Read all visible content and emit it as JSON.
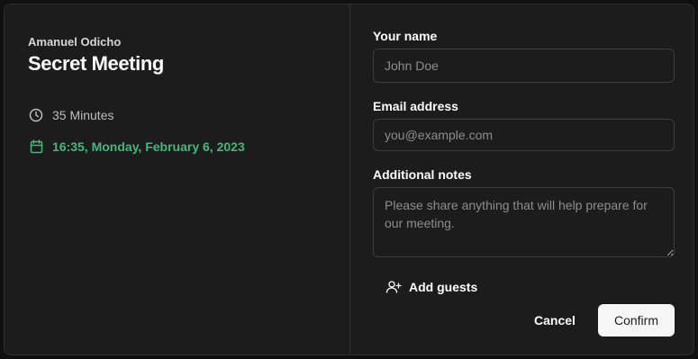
{
  "event": {
    "host": "Amanuel Odicho",
    "title": "Secret Meeting",
    "duration": "35 Minutes",
    "datetime": "16:35, Monday, February 6, 2023",
    "duration_icon": "clock-icon",
    "date_icon": "calendar-icon",
    "accent_color": "#3dbb7c"
  },
  "form": {
    "name_label": "Your name",
    "name_placeholder": "John Doe",
    "email_label": "Email address",
    "email_placeholder": "you@example.com",
    "notes_label": "Additional notes",
    "notes_placeholder": "Please share anything that will help prepare for our meeting.",
    "add_guests_label": "Add guests",
    "add_guests_icon": "user-plus-icon",
    "cancel_label": "Cancel",
    "confirm_label": "Confirm"
  }
}
